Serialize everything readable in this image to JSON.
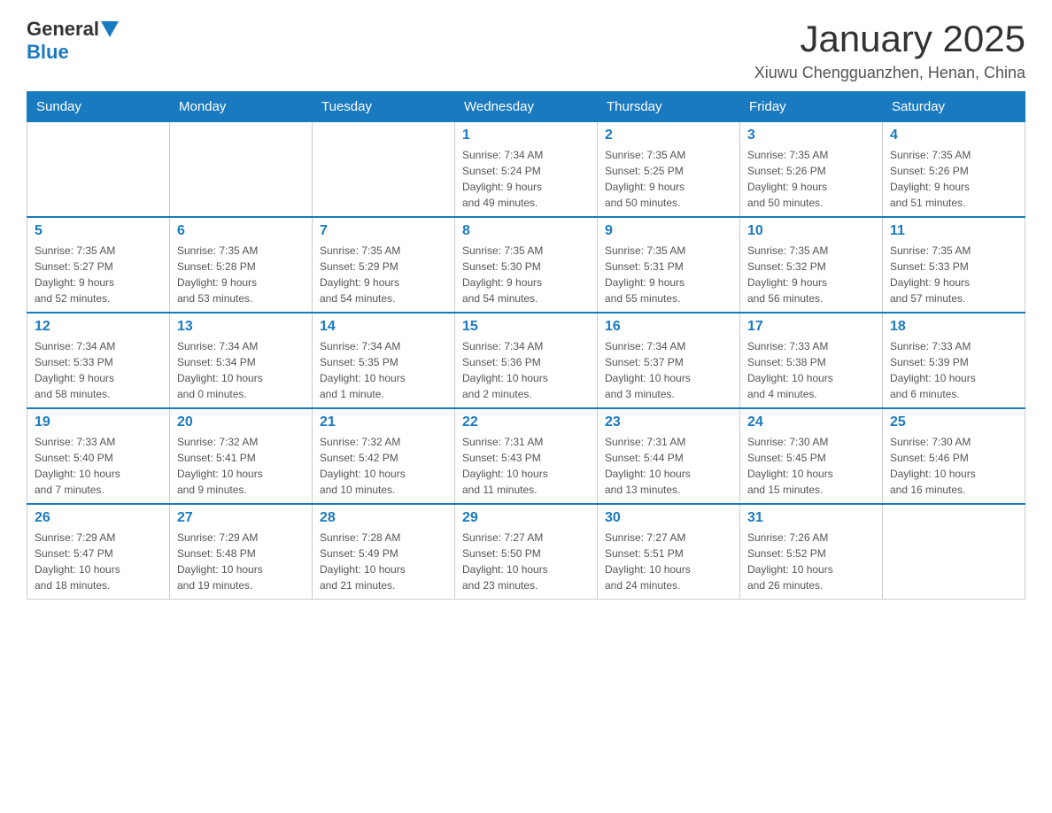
{
  "header": {
    "logo_general": "General",
    "logo_blue": "Blue",
    "month_title": "January 2025",
    "location": "Xiuwu Chengguanzhen, Henan, China"
  },
  "weekdays": [
    "Sunday",
    "Monday",
    "Tuesday",
    "Wednesday",
    "Thursday",
    "Friday",
    "Saturday"
  ],
  "weeks": [
    [
      {
        "day": "",
        "info": ""
      },
      {
        "day": "",
        "info": ""
      },
      {
        "day": "",
        "info": ""
      },
      {
        "day": "1",
        "info": "Sunrise: 7:34 AM\nSunset: 5:24 PM\nDaylight: 9 hours\nand 49 minutes."
      },
      {
        "day": "2",
        "info": "Sunrise: 7:35 AM\nSunset: 5:25 PM\nDaylight: 9 hours\nand 50 minutes."
      },
      {
        "day": "3",
        "info": "Sunrise: 7:35 AM\nSunset: 5:26 PM\nDaylight: 9 hours\nand 50 minutes."
      },
      {
        "day": "4",
        "info": "Sunrise: 7:35 AM\nSunset: 5:26 PM\nDaylight: 9 hours\nand 51 minutes."
      }
    ],
    [
      {
        "day": "5",
        "info": "Sunrise: 7:35 AM\nSunset: 5:27 PM\nDaylight: 9 hours\nand 52 minutes."
      },
      {
        "day": "6",
        "info": "Sunrise: 7:35 AM\nSunset: 5:28 PM\nDaylight: 9 hours\nand 53 minutes."
      },
      {
        "day": "7",
        "info": "Sunrise: 7:35 AM\nSunset: 5:29 PM\nDaylight: 9 hours\nand 54 minutes."
      },
      {
        "day": "8",
        "info": "Sunrise: 7:35 AM\nSunset: 5:30 PM\nDaylight: 9 hours\nand 54 minutes."
      },
      {
        "day": "9",
        "info": "Sunrise: 7:35 AM\nSunset: 5:31 PM\nDaylight: 9 hours\nand 55 minutes."
      },
      {
        "day": "10",
        "info": "Sunrise: 7:35 AM\nSunset: 5:32 PM\nDaylight: 9 hours\nand 56 minutes."
      },
      {
        "day": "11",
        "info": "Sunrise: 7:35 AM\nSunset: 5:33 PM\nDaylight: 9 hours\nand 57 minutes."
      }
    ],
    [
      {
        "day": "12",
        "info": "Sunrise: 7:34 AM\nSunset: 5:33 PM\nDaylight: 9 hours\nand 58 minutes."
      },
      {
        "day": "13",
        "info": "Sunrise: 7:34 AM\nSunset: 5:34 PM\nDaylight: 10 hours\nand 0 minutes."
      },
      {
        "day": "14",
        "info": "Sunrise: 7:34 AM\nSunset: 5:35 PM\nDaylight: 10 hours\nand 1 minute."
      },
      {
        "day": "15",
        "info": "Sunrise: 7:34 AM\nSunset: 5:36 PM\nDaylight: 10 hours\nand 2 minutes."
      },
      {
        "day": "16",
        "info": "Sunrise: 7:34 AM\nSunset: 5:37 PM\nDaylight: 10 hours\nand 3 minutes."
      },
      {
        "day": "17",
        "info": "Sunrise: 7:33 AM\nSunset: 5:38 PM\nDaylight: 10 hours\nand 4 minutes."
      },
      {
        "day": "18",
        "info": "Sunrise: 7:33 AM\nSunset: 5:39 PM\nDaylight: 10 hours\nand 6 minutes."
      }
    ],
    [
      {
        "day": "19",
        "info": "Sunrise: 7:33 AM\nSunset: 5:40 PM\nDaylight: 10 hours\nand 7 minutes."
      },
      {
        "day": "20",
        "info": "Sunrise: 7:32 AM\nSunset: 5:41 PM\nDaylight: 10 hours\nand 9 minutes."
      },
      {
        "day": "21",
        "info": "Sunrise: 7:32 AM\nSunset: 5:42 PM\nDaylight: 10 hours\nand 10 minutes."
      },
      {
        "day": "22",
        "info": "Sunrise: 7:31 AM\nSunset: 5:43 PM\nDaylight: 10 hours\nand 11 minutes."
      },
      {
        "day": "23",
        "info": "Sunrise: 7:31 AM\nSunset: 5:44 PM\nDaylight: 10 hours\nand 13 minutes."
      },
      {
        "day": "24",
        "info": "Sunrise: 7:30 AM\nSunset: 5:45 PM\nDaylight: 10 hours\nand 15 minutes."
      },
      {
        "day": "25",
        "info": "Sunrise: 7:30 AM\nSunset: 5:46 PM\nDaylight: 10 hours\nand 16 minutes."
      }
    ],
    [
      {
        "day": "26",
        "info": "Sunrise: 7:29 AM\nSunset: 5:47 PM\nDaylight: 10 hours\nand 18 minutes."
      },
      {
        "day": "27",
        "info": "Sunrise: 7:29 AM\nSunset: 5:48 PM\nDaylight: 10 hours\nand 19 minutes."
      },
      {
        "day": "28",
        "info": "Sunrise: 7:28 AM\nSunset: 5:49 PM\nDaylight: 10 hours\nand 21 minutes."
      },
      {
        "day": "29",
        "info": "Sunrise: 7:27 AM\nSunset: 5:50 PM\nDaylight: 10 hours\nand 23 minutes."
      },
      {
        "day": "30",
        "info": "Sunrise: 7:27 AM\nSunset: 5:51 PM\nDaylight: 10 hours\nand 24 minutes."
      },
      {
        "day": "31",
        "info": "Sunrise: 7:26 AM\nSunset: 5:52 PM\nDaylight: 10 hours\nand 26 minutes."
      },
      {
        "day": "",
        "info": ""
      }
    ]
  ]
}
